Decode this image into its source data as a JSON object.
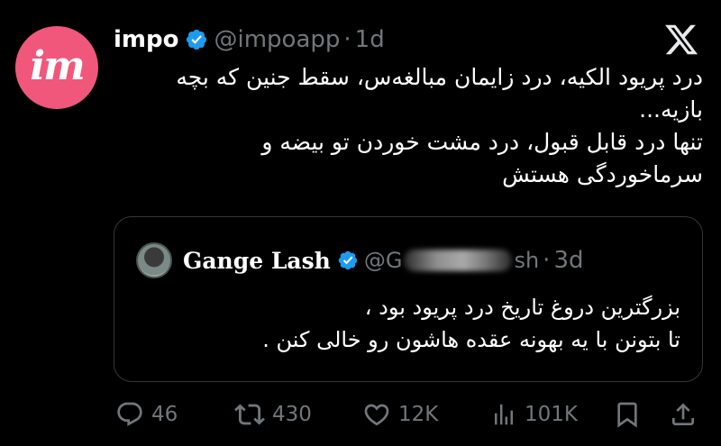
{
  "avatar": {
    "text": "im",
    "color": "#f0577b"
  },
  "tweet": {
    "name": "impo",
    "handle": "@impoapp",
    "separator": "·",
    "time": "1d",
    "lines": [
      "درد پریود الکیه، درد زایمان مبالغه‌س، سقط جنین که بچه",
      "بازیه...",
      "تنها درد قابل قبول، درد مشت خوردن تو بیضه و",
      "سرماخوردگی هستش"
    ]
  },
  "quote": {
    "name": "Gange Lash",
    "handle_start": "@G",
    "handle_end": "sh",
    "separator": "·",
    "time": "3d",
    "lines": [
      "بزرگترین دروغ تاریخ درد پریود بود ،",
      "تا بتونن با یه بهونه عقده هاشون رو خالی کنن ."
    ]
  },
  "actions": {
    "replies": "46",
    "reposts": "430",
    "likes": "12K",
    "views": "101K"
  },
  "colors": {
    "verified": "#1d9bf0",
    "muted": "#71767b",
    "background": "#000000"
  }
}
